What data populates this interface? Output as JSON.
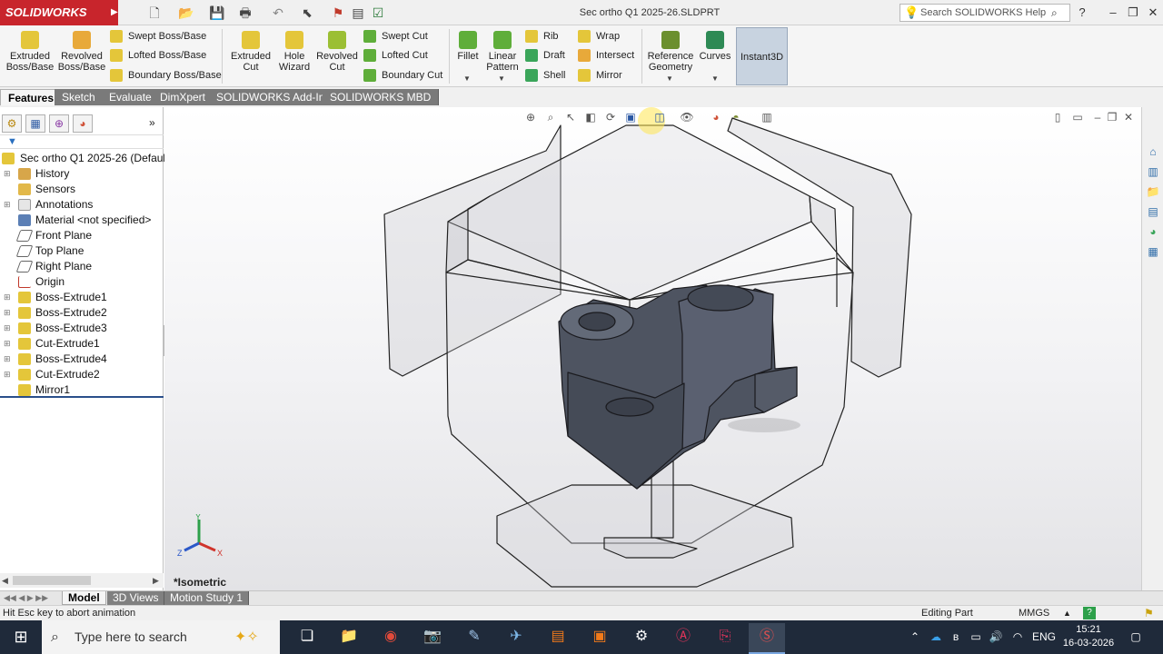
{
  "app": {
    "logo_text": "SOLIDWORKS",
    "document_title": "Sec ortho Q1 2025-26.SLDPRT",
    "search_placeholder": "Search SOLIDWORKS Help"
  },
  "ribbon": {
    "extruded_boss": "Extruded Boss/Base",
    "revolved_boss": "Revolved Boss/Base",
    "swept_boss": "Swept Boss/Base",
    "lofted_boss": "Lofted Boss/Base",
    "boundary_boss": "Boundary Boss/Base",
    "extruded_cut": "Extruded Cut",
    "hole_wizard": "Hole Wizard",
    "revolved_cut": "Revolved Cut",
    "swept_cut": "Swept Cut",
    "lofted_cut": "Lofted Cut",
    "boundary_cut": "Boundary Cut",
    "fillet": "Fillet",
    "linear_pattern": "Linear Pattern",
    "rib": "Rib",
    "draft": "Draft",
    "shell": "Shell",
    "wrap": "Wrap",
    "intersect": "Intersect",
    "mirror": "Mirror",
    "reference_geometry": "Reference Geometry",
    "curves": "Curves",
    "instant3d": "Instant3D"
  },
  "tabs": [
    {
      "label": "Features"
    },
    {
      "label": "Sketch"
    },
    {
      "label": "Evaluate"
    },
    {
      "label": "DimXpert"
    },
    {
      "label": "SOLIDWORKS Add-Ins"
    },
    {
      "label": "SOLIDWORKS MBD"
    }
  ],
  "tree": {
    "root": "Sec ortho Q1 2025-26  (Default<",
    "items": [
      {
        "label": "History"
      },
      {
        "label": "Sensors"
      },
      {
        "label": "Annotations"
      },
      {
        "label": "Material <not specified>"
      },
      {
        "label": "Front Plane"
      },
      {
        "label": "Top Plane"
      },
      {
        "label": "Right Plane"
      },
      {
        "label": "Origin"
      },
      {
        "label": "Boss-Extrude1"
      },
      {
        "label": "Boss-Extrude2"
      },
      {
        "label": "Boss-Extrude3"
      },
      {
        "label": "Cut-Extrude1"
      },
      {
        "label": "Boss-Extrude4"
      },
      {
        "label": "Cut-Extrude2"
      },
      {
        "label": "Mirror1"
      }
    ]
  },
  "viewport": {
    "view_name": "*Isometric",
    "triad_x": "X",
    "triad_y": "Y",
    "triad_z": "Z"
  },
  "model_tabs": [
    {
      "label": "Model"
    },
    {
      "label": "3D Views"
    },
    {
      "label": "Motion Study 1"
    }
  ],
  "status": {
    "message": "Hit Esc key to abort animation",
    "mode": "Editing Part",
    "units": "MMGS"
  },
  "taskbar": {
    "search_text": "Type here to search",
    "language": "ENG",
    "time": "15:21",
    "date": "16-03-2026"
  },
  "colors": {
    "brand": "#c8252c",
    "taskbar": "#1f2a3a",
    "model_fill": "#4e5461"
  }
}
